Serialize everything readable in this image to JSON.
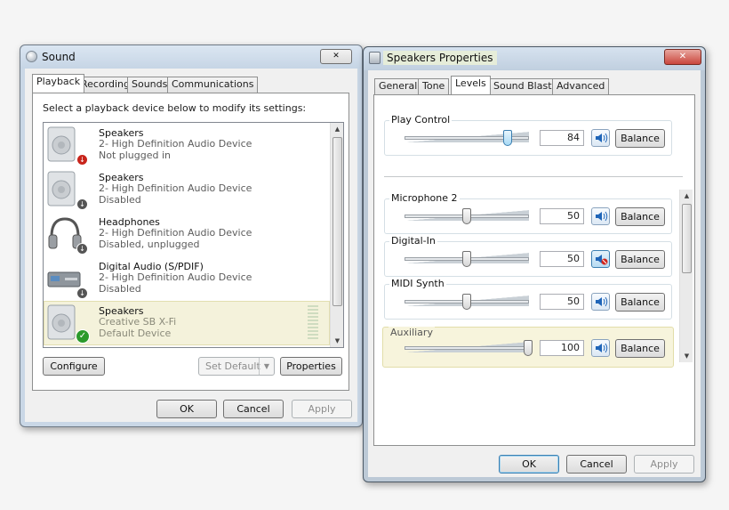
{
  "sound": {
    "title": "Sound",
    "close_glyph": "✕",
    "tabs": [
      "Playback",
      "Recording",
      "Sounds",
      "Communications"
    ],
    "instruction": "Select a playback device below to modify its settings:",
    "devices": [
      {
        "name": "Speakers",
        "line1": "2- High Definition Audio Device",
        "line2": "Not plugged in",
        "icon": "speaker-icon",
        "status": "not-plugged-in",
        "status_color": "#c8241b"
      },
      {
        "name": "Speakers",
        "line1": "2- High Definition Audio Device",
        "line2": "Disabled",
        "icon": "speaker-icon",
        "status": "disabled",
        "status_color": "#555555"
      },
      {
        "name": "Headphones",
        "line1": "2- High Definition Audio Device",
        "line2": "Disabled, unplugged",
        "icon": "headphones-icon",
        "status": "disabled",
        "status_color": "#555555"
      },
      {
        "name": "Digital Audio (S/PDIF)",
        "line1": "2- High Definition Audio Device",
        "line2": "Disabled",
        "icon": "digital-audio-icon",
        "status": "disabled",
        "status_color": "#555555"
      },
      {
        "name": "Speakers",
        "line1": "Creative SB X-Fi",
        "line2": "Default Device",
        "icon": "speaker-icon",
        "status": "default",
        "status_color": "#2b9a2b"
      }
    ],
    "buttons": {
      "configure": "Configure",
      "set_default": "Set Default",
      "properties": "Properties",
      "ok": "OK",
      "cancel": "Cancel",
      "apply": "Apply"
    }
  },
  "props": {
    "title": "Speakers Properties",
    "close_glyph": "✕",
    "tabs": [
      "General",
      "Tone",
      "Levels",
      "Sound Blaster",
      "Advanced"
    ],
    "active_tab": "Levels",
    "master": {
      "label": "Play Control",
      "value": "84",
      "balance": "Balance"
    },
    "channels": [
      {
        "label": "Microphone 2",
        "value": "50",
        "muted": false,
        "balance": "Balance"
      },
      {
        "label": "Digital-In",
        "value": "50",
        "muted": true,
        "balance": "Balance"
      },
      {
        "label": "MIDI Synth",
        "value": "50",
        "muted": false,
        "balance": "Balance"
      },
      {
        "label": "Auxiliary",
        "value": "100",
        "muted": false,
        "balance": "Balance"
      }
    ],
    "buttons": {
      "ok": "OK",
      "cancel": "Cancel",
      "apply": "Apply"
    },
    "colors": {
      "accent": "#3c7fb1",
      "close_red": "#c9463d",
      "mute_red": "#d1261d"
    }
  }
}
